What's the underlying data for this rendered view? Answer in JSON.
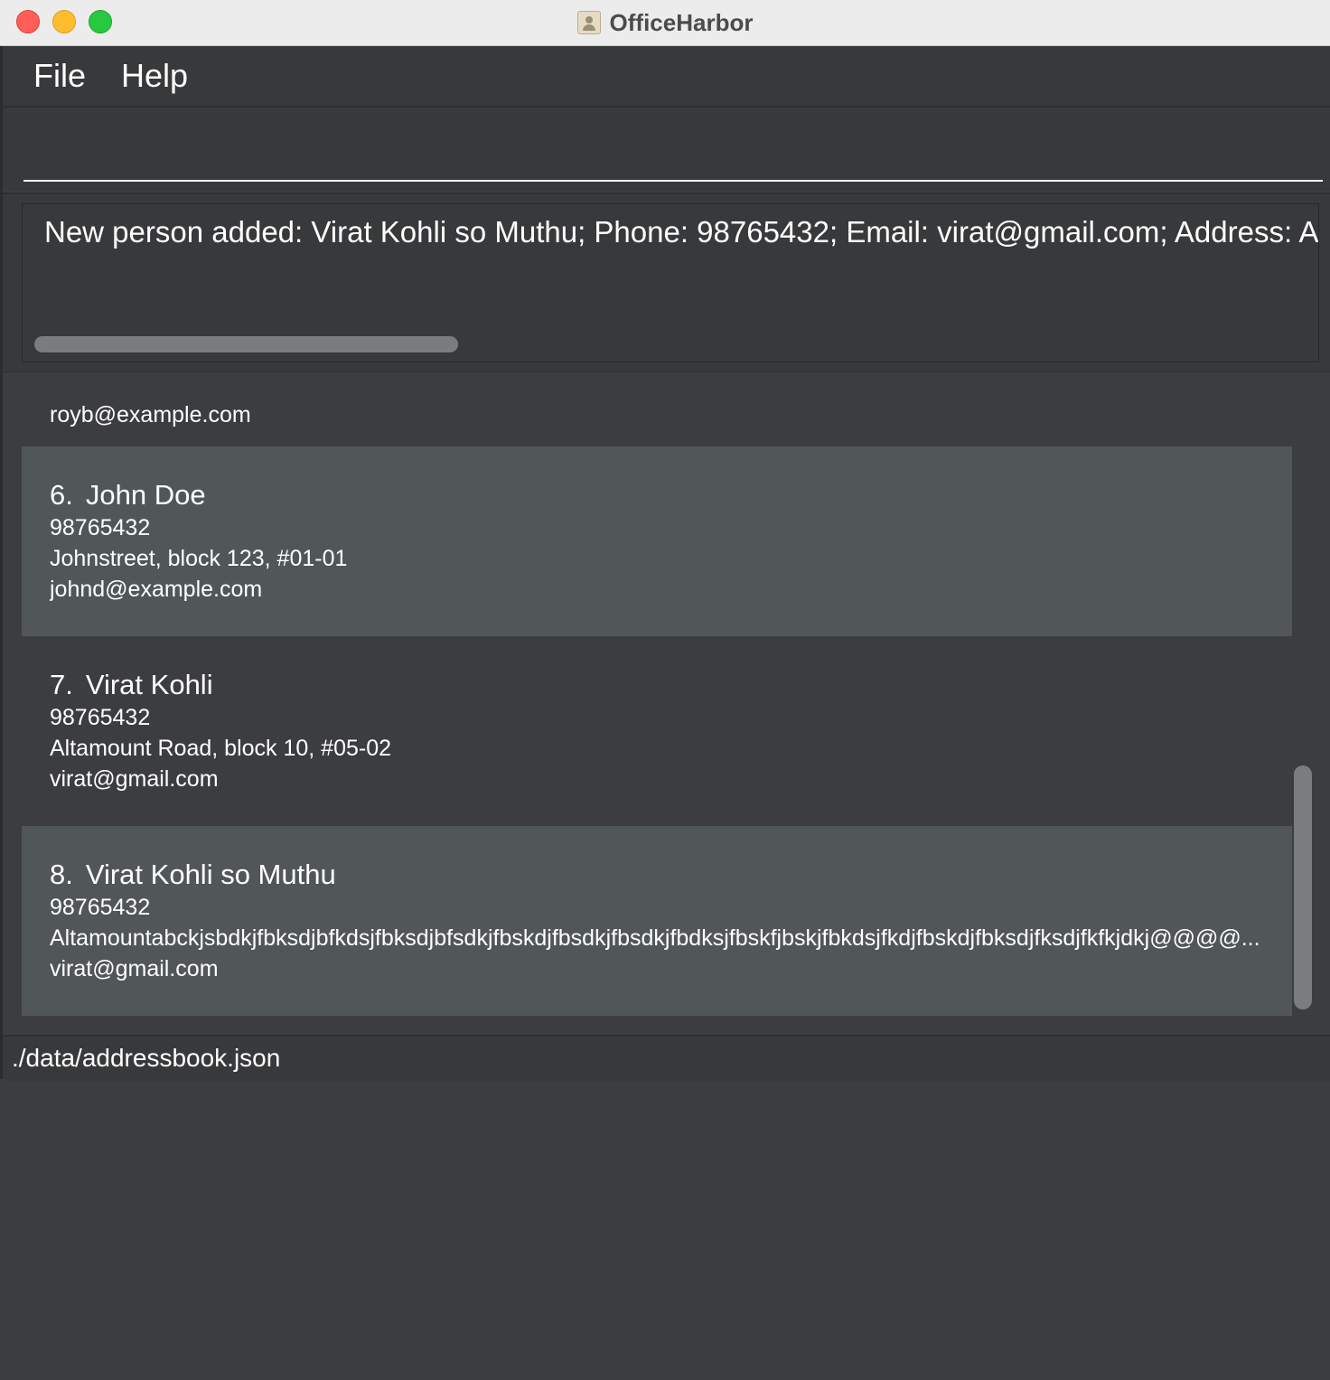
{
  "window": {
    "title": "OfficeHarbor"
  },
  "menu": {
    "file": "File",
    "help": "Help"
  },
  "command": {
    "value": "",
    "placeholder": ""
  },
  "result": {
    "text": "New person added: Virat Kohli so Muthu; Phone: 98765432; Email: virat@gmail.com; Address: Altamountabckjsbdkjfbksdjbfkdsjfbksdjbfsdkjfbskdjfbsdkjfbsdkjfbdksjfbskfjbskjfbkdsjfkdjfbskdjfbksdjfksdjfkfkjdkj@@@@; Tags: "
  },
  "persons": [
    {
      "index": "",
      "name": "",
      "phone": "",
      "address": "",
      "email": "royb@example.com"
    },
    {
      "index": "6.",
      "name": "John Doe",
      "phone": "98765432",
      "address": "Johnstreet, block 123, #01-01",
      "email": "johnd@example.com"
    },
    {
      "index": "7.",
      "name": "Virat Kohli",
      "phone": "98765432",
      "address": "Altamount Road, block 10, #05-02",
      "email": "virat@gmail.com"
    },
    {
      "index": "8.",
      "name": "Virat Kohli so Muthu",
      "phone": "98765432",
      "address": "Altamountabckjsbdkjfbksdjbfkdsjfbksdjbfsdkjfbskdjfbsdkjfbsdkjfbdksjfbskfjbskjfbkdsjfkdjfbskdjfbksdjfksdjfkfkjdkj@@@@...",
      "email": "virat@gmail.com"
    }
  ],
  "status": {
    "path": "./data/addressbook.json"
  },
  "colors": {
    "card_dark": "#3c3d40",
    "card_light": "#515658",
    "menubar": "#38393b"
  }
}
